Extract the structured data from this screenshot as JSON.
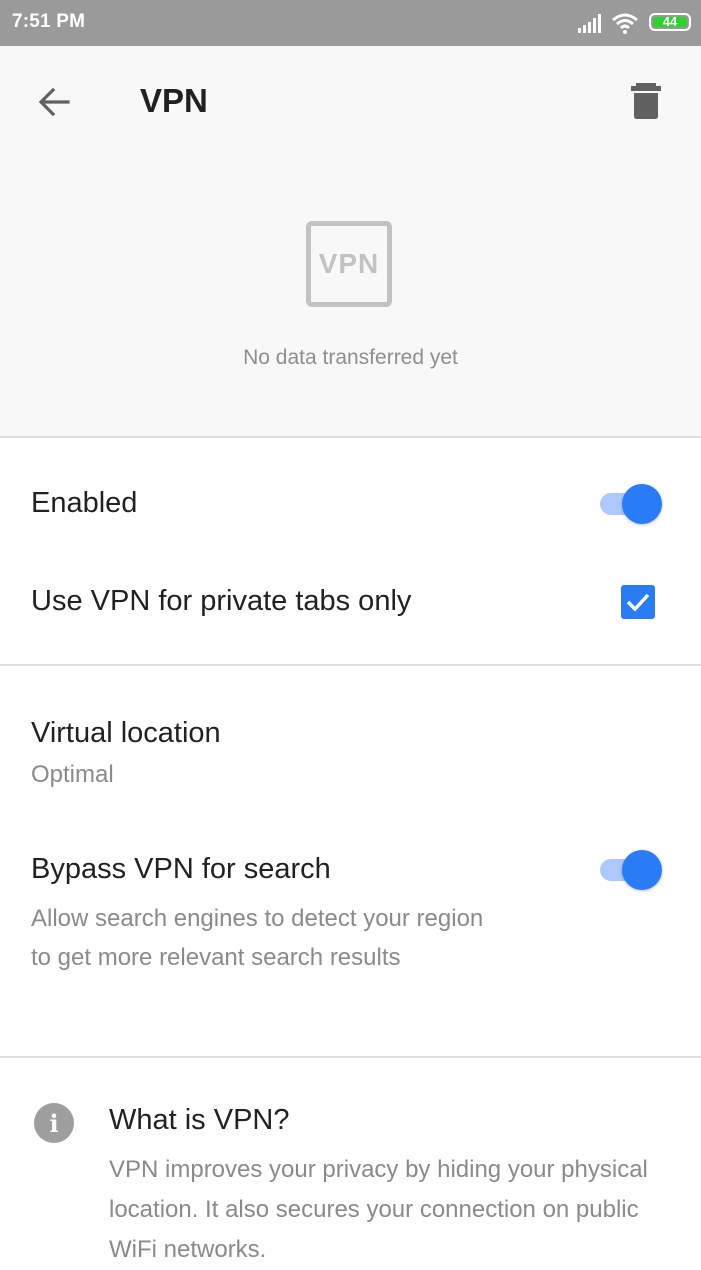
{
  "status_bar": {
    "time": "7:51 PM",
    "battery": "44",
    "icons": [
      "signal-icon",
      "wifi-icon",
      "battery-icon"
    ],
    "background": "#9a9a9a"
  },
  "header": {
    "title": "VPN",
    "back_icon": "arrow-left-icon",
    "delete_icon": "trash-icon",
    "logo_text": "VPN",
    "data_status": "No data transferred yet"
  },
  "settings": {
    "enabled": {
      "label": "Enabled",
      "on": true
    },
    "private_tabs": {
      "label": "Use VPN for private tabs only",
      "checked": true
    },
    "virtual_location": {
      "label": "Virtual location",
      "value": "Optimal"
    },
    "bypass": {
      "label": "Bypass VPN for search",
      "description": "Allow search engines to detect your region to get more relevant search results",
      "on": true
    }
  },
  "info": {
    "icon": "info-icon",
    "title": "What is VPN?",
    "body": "VPN improves your privacy by hiding your physical location. It also secures your connection on public WiFi networks."
  },
  "colors": {
    "accent": "#2a7cf6",
    "toggle_track": "#adc8ff",
    "header_bg": "#f8f8f8",
    "secondary_text": "#8a8a8a"
  }
}
